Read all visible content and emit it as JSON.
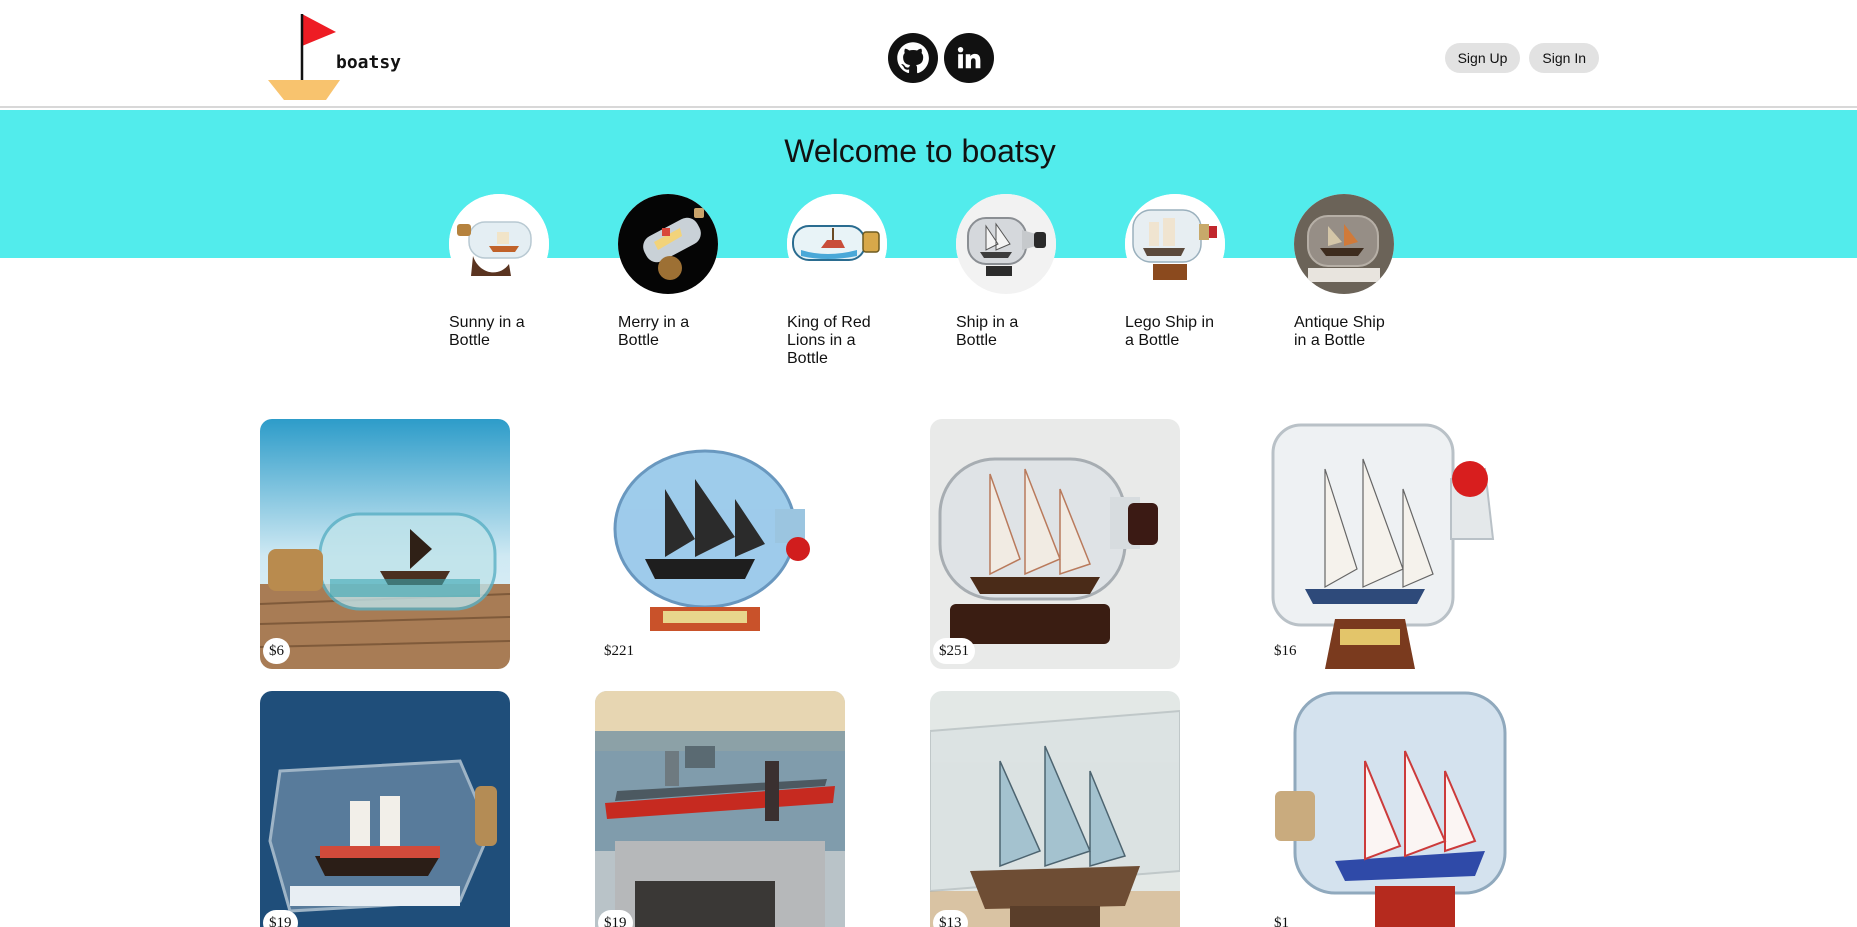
{
  "app": {
    "name": "boatsy"
  },
  "header": {
    "logo_text": "boatsy",
    "social": [
      {
        "icon": "github-icon"
      },
      {
        "icon": "linkedin-icon"
      }
    ],
    "sign_up_label": "Sign Up",
    "sign_in_label": "Sign In"
  },
  "hero": {
    "title": "Welcome to boatsy",
    "background_color": "#52ecec"
  },
  "categories": [
    {
      "label": "Sunny in a Bottle"
    },
    {
      "label": "Merry in a Bottle"
    },
    {
      "label": "King of Red Lions in a Bottle"
    },
    {
      "label": "Ship in a Bottle"
    },
    {
      "label": "Lego Ship in a Bottle"
    },
    {
      "label": "Antique Ship in a Bottle"
    }
  ],
  "products": [
    {
      "price": "$6"
    },
    {
      "price": "$221"
    },
    {
      "price": "$251"
    },
    {
      "price": "$16"
    },
    {
      "price": "$19"
    },
    {
      "price": "$19"
    },
    {
      "price": "$13"
    },
    {
      "price": "$1"
    }
  ]
}
